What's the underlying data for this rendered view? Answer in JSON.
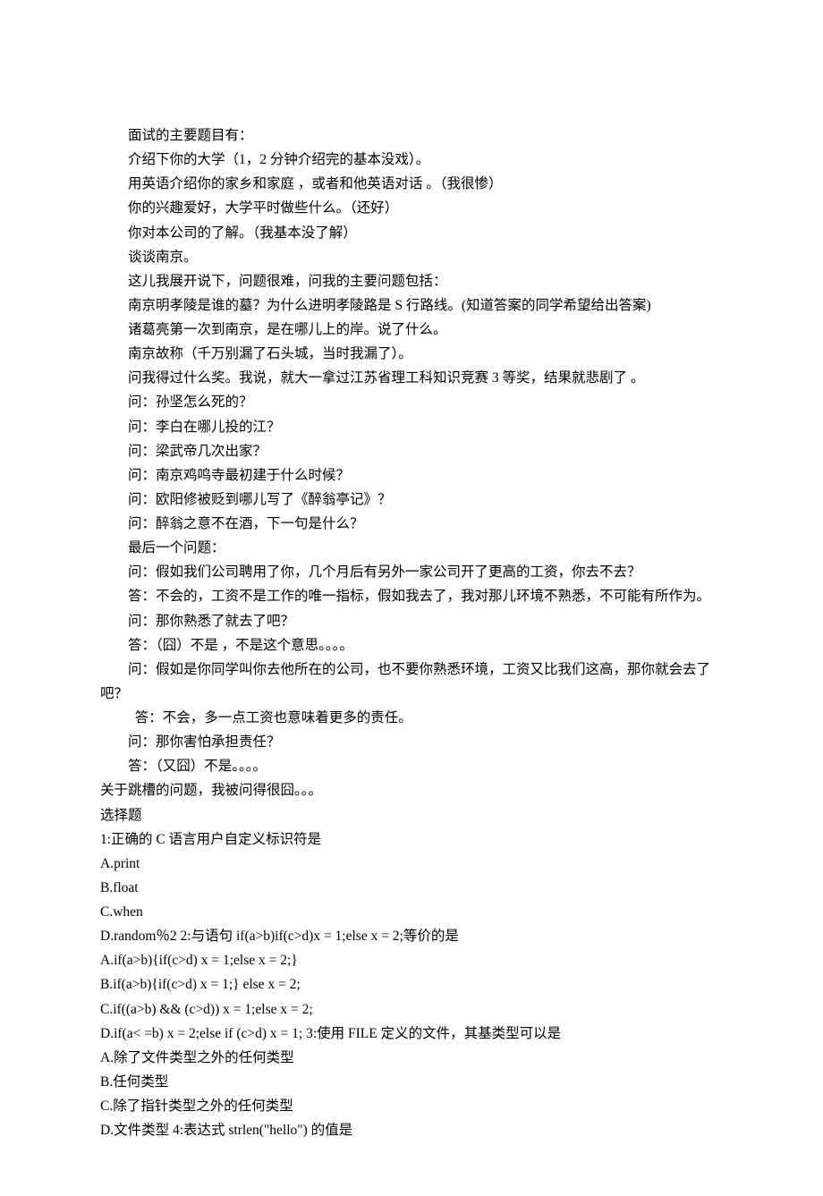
{
  "lines": [
    {
      "cls": "para",
      "text": "面试的主要题目有："
    },
    {
      "cls": "para",
      "text": "介绍下你的大学（1，2 分钟介绍完的基本没戏）。"
    },
    {
      "cls": "para",
      "text": "用英语介绍你的家乡和家庭 ，或者和他英语对话 。（我很惨）"
    },
    {
      "cls": "para",
      "text": "你的兴趣爱好，大学平时做些什么。（还好）"
    },
    {
      "cls": "para",
      "text": "你对本公司的了解。（我基本没了解）"
    },
    {
      "cls": "para",
      "text": "谈谈南京。"
    },
    {
      "cls": "para",
      "text": "这儿我展开说下，问题很难，问我的主要问题包括："
    },
    {
      "cls": "para",
      "text": "南京明孝陵是谁的墓？为什么进明孝陵路是 S 行路线。(知道答案的同学希望给出答案)"
    },
    {
      "cls": "para",
      "text": "诸葛亮第一次到南京，是在哪儿上的岸。说了什么。"
    },
    {
      "cls": "para",
      "text": "南京故称（千万别漏了石头城，当时我漏了）。"
    },
    {
      "cls": "para",
      "text": "问我得过什么奖。我说，就大一拿过江苏省理工科知识竞赛 3 等奖，结果就悲剧了 。"
    },
    {
      "cls": "para",
      "text": "问：孙坚怎么死的？"
    },
    {
      "cls": "para",
      "text": "问：李白在哪儿投的江？"
    },
    {
      "cls": "para",
      "text": "问：梁武帝几次出家？"
    },
    {
      "cls": "para",
      "text": "问：南京鸡鸣寺最初建于什么时候？"
    },
    {
      "cls": "para",
      "text": "问：欧阳修被贬到哪儿写了《醉翁亭记》？"
    },
    {
      "cls": "para",
      "text": "问：醉翁之意不在酒，下一句是什么？"
    },
    {
      "cls": "para",
      "text": "最后一个问题："
    },
    {
      "cls": "para",
      "text": "问：假如我们公司聘用了你，几个月后有另外一家公司开了更高的工资，你去不去？"
    },
    {
      "cls": "para",
      "text": "答：不会的，工资不是工作的唯一指标，假如我去了，我对那儿环境不熟悉，不可能有所作为。"
    },
    {
      "cls": "para",
      "text": "问：那你熟悉了就去了吧？"
    },
    {
      "cls": "para",
      "text": "答：（囧）不是 ，不是这个意思。。。。"
    },
    {
      "cls": "para",
      "text": "问：假如是你同学叫你去他所在的公司，也不要你熟悉环境，工资又比我们这高，那你就会去了吧？"
    },
    {
      "cls": "para-extra-indent",
      "text": "答：不会，多一点工资也意味着更多的责任。"
    },
    {
      "cls": "para",
      "text": "问：那你害怕承担责任？"
    },
    {
      "cls": "para",
      "text": "答：（又囧）不是。。。。"
    },
    {
      "cls": "para-no-indent",
      "text": "关于跳槽的问题，我被问得很囧。。。"
    },
    {
      "cls": "para-no-indent",
      "text": "选择题"
    },
    {
      "cls": "para-no-indent",
      "text": "1:正确的 C 语言用户自定义标识符是"
    },
    {
      "cls": "para-no-indent",
      "text": "A.print"
    },
    {
      "cls": "para-no-indent",
      "text": "B.float"
    },
    {
      "cls": "para-no-indent",
      "text": "C.when"
    },
    {
      "cls": "para-no-indent",
      "text": "D.random％2 2:与语句 if(a>b)if(c>d)x = 1;else x = 2;等价的是"
    },
    {
      "cls": "para-no-indent",
      "text": "A.if(a>b){if(c>d) x = 1;else x = 2;}"
    },
    {
      "cls": "para-no-indent",
      "text": "B.if(a>b){if(c>d) x = 1;} else x = 2;"
    },
    {
      "cls": "para-no-indent",
      "text": "C.if((a>b) && (c>d)) x = 1;else x = 2;"
    },
    {
      "cls": "para-no-indent",
      "text": "D.if(a< =b) x = 2;else if (c>d) x = 1; 3:使用 FILE 定义的文件，其基类型可以是"
    },
    {
      "cls": "para-no-indent",
      "text": "A.除了文件类型之外的任何类型"
    },
    {
      "cls": "para-no-indent",
      "text": "B.任何类型"
    },
    {
      "cls": "para-no-indent",
      "text": "C.除了指针类型之外的任何类型"
    },
    {
      "cls": "para-no-indent",
      "text": "D.文件类型 4:表达式 strlen(\"hello\") 的值是"
    }
  ]
}
